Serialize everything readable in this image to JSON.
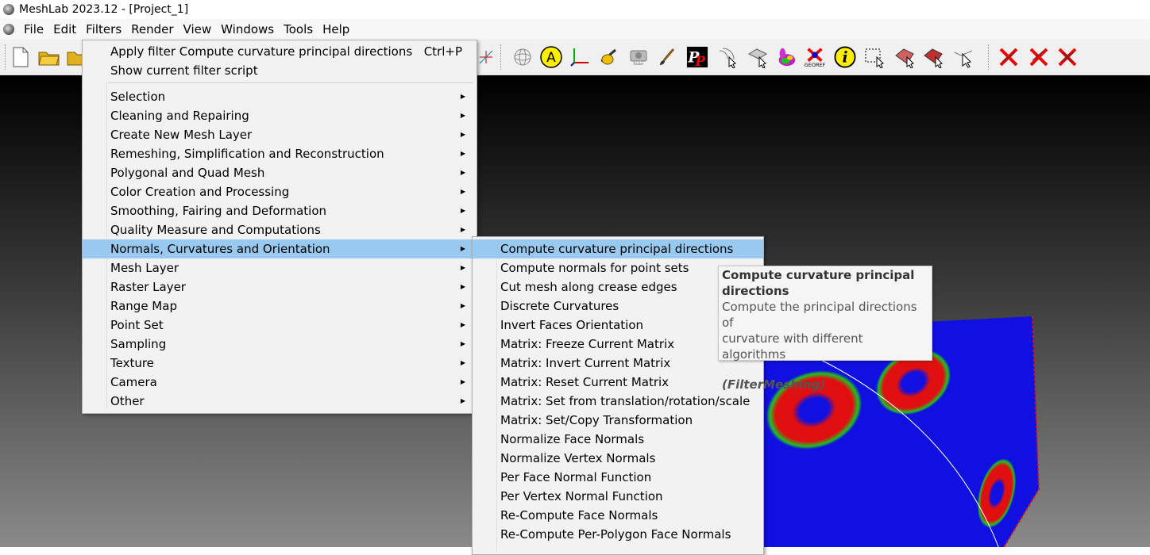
{
  "window": {
    "title": "MeshLab 2023.12 - [Project_1]"
  },
  "menubar": {
    "items": [
      {
        "label": "File"
      },
      {
        "label": "Edit"
      },
      {
        "label": "Filters"
      },
      {
        "label": "Render"
      },
      {
        "label": "View"
      },
      {
        "label": "Windows"
      },
      {
        "label": "Tools"
      },
      {
        "label": "Help"
      }
    ]
  },
  "toolbar": {
    "icons": [
      "new-file-icon",
      "open-folder-icon",
      "open-folder-icon",
      "measure-axis-icon",
      "sphere-icon",
      "annotation-a-icon",
      "axes-icon",
      "align-icon",
      "raster-alignment-icon",
      "paint-brush-icon",
      "pick-points-icon",
      "select-vertices-icon",
      "select-faces-icon",
      "bunny-icon",
      "georef-icon",
      "info-icon",
      "select-rect-icon",
      "select-faces-paint-icon",
      "select-connected-icon",
      "select-z-icon",
      "delete-vertices-icon",
      "delete-faces-icon",
      "delete-faces-vertices-icon"
    ],
    "georef_label": "GEOREF",
    "raster_label": "Raster Alignment"
  },
  "filters_menu": {
    "top_items": [
      {
        "label": "Apply filter Compute curvature principal directions",
        "shortcut": "Ctrl+P"
      },
      {
        "label": "Show current filter script",
        "shortcut": ""
      }
    ],
    "categories": [
      {
        "label": "Selection"
      },
      {
        "label": "Cleaning and Repairing"
      },
      {
        "label": "Create New Mesh Layer"
      },
      {
        "label": "Remeshing, Simplification and Reconstruction"
      },
      {
        "label": "Polygonal and Quad Mesh"
      },
      {
        "label": "Color Creation and Processing"
      },
      {
        "label": "Smoothing, Fairing and Deformation"
      },
      {
        "label": "Quality Measure and Computations"
      },
      {
        "label": "Normals, Curvatures and Orientation"
      },
      {
        "label": "Mesh Layer"
      },
      {
        "label": "Raster Layer"
      },
      {
        "label": "Range Map"
      },
      {
        "label": "Point Set"
      },
      {
        "label": "Sampling"
      },
      {
        "label": "Texture"
      },
      {
        "label": "Camera"
      },
      {
        "label": "Other"
      }
    ],
    "highlighted_category": "Normals, Curvatures and Orientation"
  },
  "submenu": {
    "items": [
      {
        "label": "Compute curvature principal directions"
      },
      {
        "label": "Compute normals for point sets"
      },
      {
        "label": "Cut mesh along crease edges"
      },
      {
        "label": "Discrete Curvatures"
      },
      {
        "label": "Invert Faces Orientation"
      },
      {
        "label": "Matrix: Freeze Current Matrix"
      },
      {
        "label": "Matrix: Invert Current Matrix"
      },
      {
        "label": "Matrix: Reset Current Matrix"
      },
      {
        "label": "Matrix: Set from translation/rotation/scale"
      },
      {
        "label": "Matrix: Set/Copy Transformation"
      },
      {
        "label": "Normalize Face Normals"
      },
      {
        "label": "Normalize Vertex Normals"
      },
      {
        "label": "Per Face Normal Function"
      },
      {
        "label": "Per Vertex Normal Function"
      },
      {
        "label": "Re-Compute Face Normals"
      },
      {
        "label": "Re-Compute Per-Polygon Face Normals"
      }
    ],
    "highlighted_item": "Compute curvature principal directions"
  },
  "tooltip": {
    "title_line1": "Compute curvature principal",
    "title_line2": "directions",
    "desc_line1": "Compute the principal directions of",
    "desc_line2": "curvature with different algorithms",
    "filter_class": "(FilterMeshing)"
  },
  "colors": {
    "menu_highlight": "#99c9ef",
    "menu_bg": "#f2f2f2",
    "mesh_blue": "#1010e0",
    "mesh_red": "#e01010"
  }
}
